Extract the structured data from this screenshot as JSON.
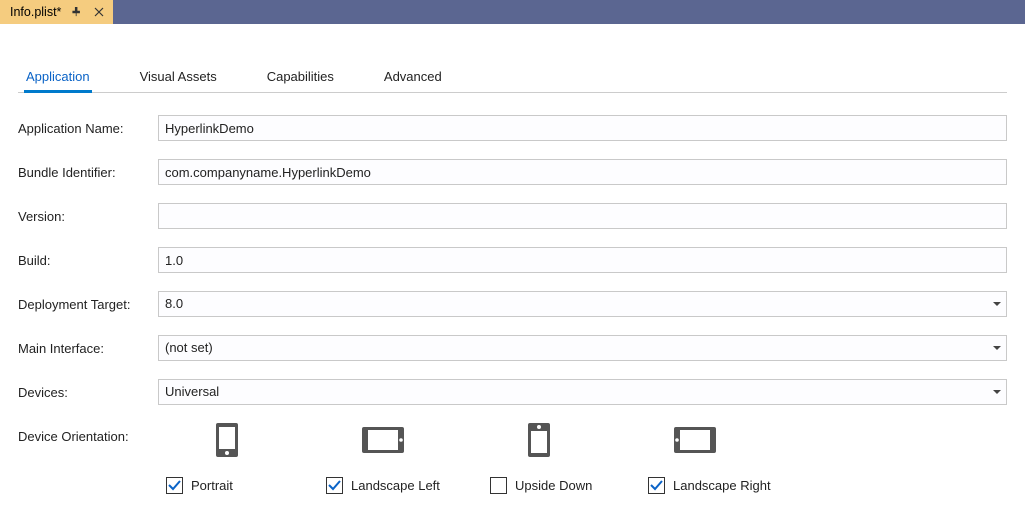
{
  "documentTab": {
    "title": "Info.plist*"
  },
  "tabs": [
    "Application",
    "Visual Assets",
    "Capabilities",
    "Advanced"
  ],
  "activeTab": 0,
  "fields": {
    "appName": {
      "label": "Application Name:",
      "value": "HyperlinkDemo"
    },
    "bundleId": {
      "label": "Bundle Identifier:",
      "value": "com.companyname.HyperlinkDemo"
    },
    "version": {
      "label": "Version:",
      "value": ""
    },
    "build": {
      "label": "Build:",
      "value": "1.0"
    },
    "deployTgt": {
      "label": "Deployment Target:",
      "value": "8.0"
    },
    "mainIf": {
      "label": "Main Interface:",
      "value": "(not set)"
    },
    "devices": {
      "label": "Devices:",
      "value": "Universal"
    }
  },
  "orientation": {
    "label": "Device Orientation:",
    "options": [
      {
        "key": "portrait",
        "label": "Portrait",
        "checked": true
      },
      {
        "key": "landscape_left",
        "label": "Landscape Left",
        "checked": true
      },
      {
        "key": "upside_down",
        "label": "Upside Down",
        "checked": false
      },
      {
        "key": "landscape_right",
        "label": "Landscape Right",
        "checked": true
      }
    ]
  }
}
